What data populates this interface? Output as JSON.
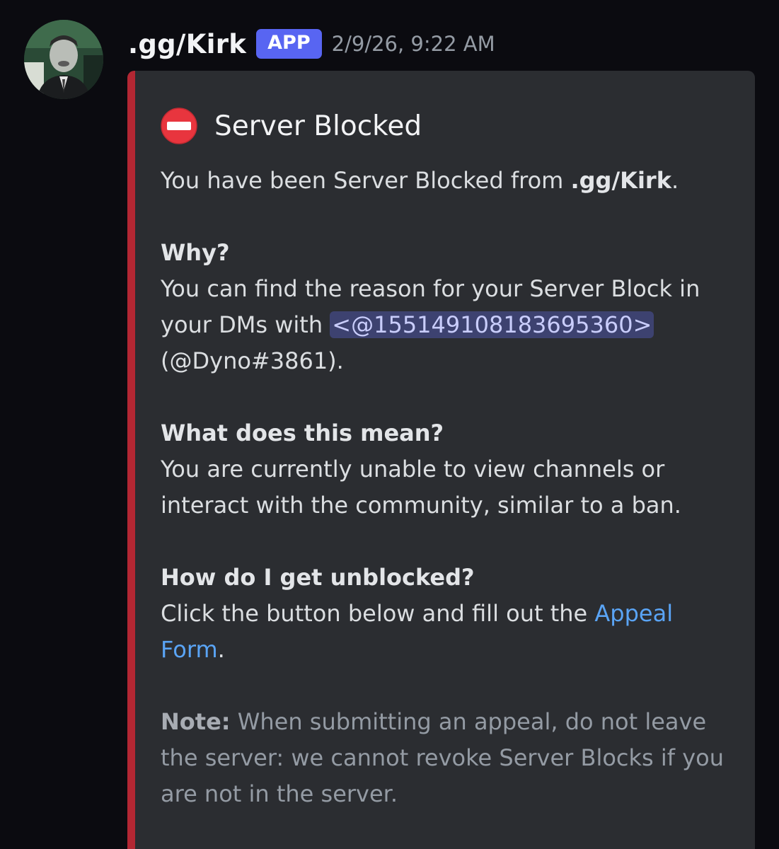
{
  "message": {
    "username": ".gg/Kirk",
    "badge": "APP",
    "timestamp": "2/9/26, 9:22 AM",
    "avatar_icon": "profile-photo"
  },
  "embed": {
    "accent_color": "#b32733",
    "title_icon": "no-entry-icon",
    "title": "Server Blocked",
    "intro_prefix": "You have been Server Blocked from ",
    "intro_server": ".gg/Kirk",
    "intro_suffix": ".",
    "why_heading": "Why?",
    "why_text": "You can find the reason for your Server Block in your DMs with ",
    "why_mention": "<@155149108183695360>",
    "why_user": "(@Dyno#3861).",
    "meaning_heading": "What does this mean?",
    "meaning_text": "You are currently unable to view channels or interact with the community, similar to a ban.",
    "unblock_heading": "How do I get unblocked?",
    "unblock_text": "Click the button below and fill out the ",
    "unblock_link": "Appeal Form",
    "unblock_suffix": ".",
    "note_label": "Note:",
    "note_text": " When submitting an appeal, do not leave the server: we cannot revoke Server Blocks if you are not in the server."
  },
  "colors": {
    "background": "#0b0b10",
    "embed_background": "#2b2d31",
    "badge": "#5865f2",
    "link": "#5aa4f5",
    "mention_bg": "#3d4270"
  }
}
